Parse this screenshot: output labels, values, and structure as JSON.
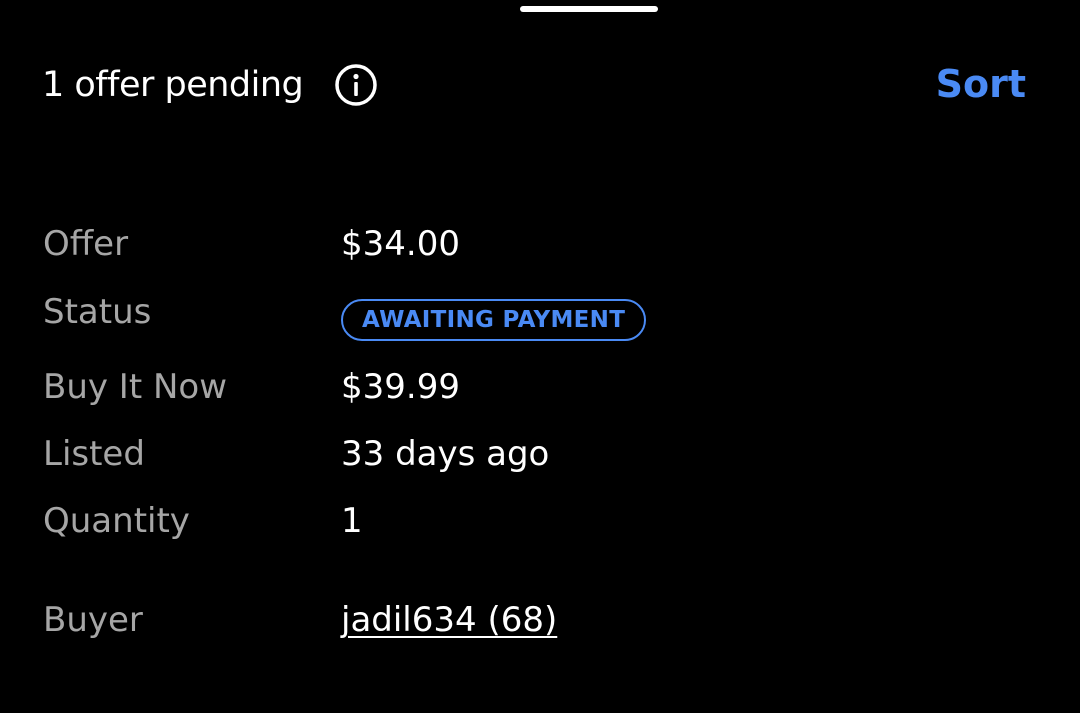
{
  "header": {
    "title": "1 offer pending",
    "info_icon": "info-circle-icon",
    "sort_label": "Sort"
  },
  "details": {
    "offer": {
      "label": "Offer",
      "value": "$34.00"
    },
    "status": {
      "label": "Status",
      "value": "AWAITING PAYMENT"
    },
    "buy_it_now": {
      "label": "Buy It Now",
      "value": "$39.99"
    },
    "listed": {
      "label": "Listed",
      "value": "33 days ago"
    },
    "quantity": {
      "label": "Quantity",
      "value": "1"
    },
    "buyer": {
      "label": "Buyer",
      "value": "jadil634 (68)"
    }
  },
  "colors": {
    "background": "#000000",
    "accent": "#4a8af4",
    "label": "#a6a6a6",
    "text": "#ffffff"
  }
}
